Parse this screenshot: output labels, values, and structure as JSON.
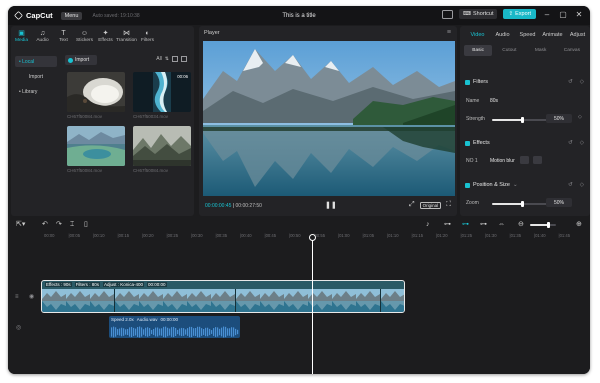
{
  "app": {
    "name": "CapCut",
    "menu_label": "Menu",
    "autosave": "Auto saved: 19:10:38",
    "doc_title": "This is a title",
    "shortcut_label": "Shortcut",
    "export_label": "Export"
  },
  "media_tabs": [
    {
      "label": "Media",
      "icon": "media-icon",
      "glyph": "▣"
    },
    {
      "label": "Audio",
      "icon": "audio-icon",
      "glyph": "♫"
    },
    {
      "label": "Text",
      "icon": "text-icon",
      "glyph": "T"
    },
    {
      "label": "Stickers",
      "icon": "sticker-icon",
      "glyph": "☺"
    },
    {
      "label": "Effects",
      "icon": "effects-icon",
      "glyph": "✦"
    },
    {
      "label": "Transition",
      "icon": "transition-icon",
      "glyph": "⋈"
    },
    {
      "label": "Filters",
      "icon": "filters-icon",
      "glyph": "◐"
    }
  ],
  "media_side": {
    "local": "• Local",
    "import": "Import",
    "library": "• Library"
  },
  "media_main": {
    "import_label": "Import",
    "all_label": "All"
  },
  "media_items": [
    {
      "caption": "CH67f50084.mov",
      "duration": ""
    },
    {
      "caption": "CH67f50034.mov",
      "duration": "00:06"
    },
    {
      "caption": "CH67f50084.mov",
      "duration": ""
    },
    {
      "caption": "CH67f50084.mov",
      "duration": ""
    }
  ],
  "player": {
    "title": "Player",
    "current_time": "00:00:00:45",
    "total_time": "00:00:27:50",
    "original_label": "Original"
  },
  "inspector": {
    "tabs": [
      "Video",
      "Audio",
      "Speed",
      "Animate",
      "Adjust"
    ],
    "subtabs": [
      "Basic",
      "Cutout",
      "Mask",
      "Canvas"
    ],
    "filters_title": "Filters",
    "name_label": "Name",
    "name_value": "80s",
    "strength_label": "Strength",
    "strength_value": "50%",
    "strength_level": 0.5,
    "effects_title": "Effects",
    "effect_slot": "NO 1",
    "effect_name": "Motion blur",
    "position_title": "Position & Size",
    "zoom_label": "Zoom",
    "zoom_value": "50%",
    "zoom_level": 0.5
  },
  "timeline": {
    "ruler_labels": [
      "00:00",
      "|00:05",
      "|00:10",
      "|00:15",
      "|00:20",
      "|00:25",
      "|00:30",
      "|00:35",
      "|00:40",
      "|00:45",
      "|00:50",
      "|00:55",
      "|01:00",
      "|01:05",
      "|01:10",
      "|01:15",
      "|01:20",
      "|01:25",
      "|01:30",
      "|01:35",
      "|01:40",
      "|01:45"
    ],
    "video_clip_tags": [
      "Effects : 90s",
      "Filters : 80s",
      "Adjust : Konica-400",
      "00:00:00"
    ],
    "audio_clip_tags": [
      "Speed 2.0x",
      "Audio.wav",
      "00:00:00"
    ]
  },
  "colors": {
    "accent": "#19c3d2",
    "window_bg": "#1c1c1e",
    "panel_bg": "#232326",
    "audio_clip": "#1c4d7c"
  }
}
